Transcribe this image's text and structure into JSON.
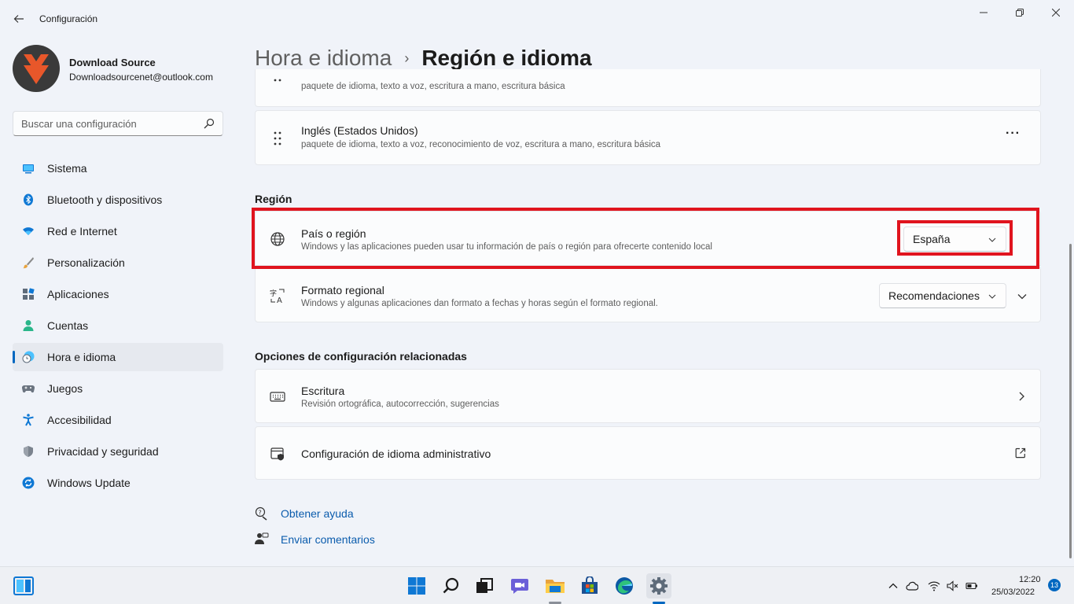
{
  "window": {
    "title": "Configuración",
    "back_icon": "arrow-left-icon",
    "controls": [
      "minimize-icon",
      "maximize-icon",
      "close-icon"
    ]
  },
  "user": {
    "name": "Download Source",
    "email": "Downloadsourcenet@outlook.com",
    "avatar_colors": {
      "bg": "#3a3a3a",
      "logo": "#e8572a"
    }
  },
  "search": {
    "placeholder": "Buscar una configuración",
    "icon": "search-icon"
  },
  "sidebar": {
    "items": [
      {
        "label": "Sistema",
        "icon": "system-icon",
        "active": false
      },
      {
        "label": "Bluetooth y dispositivos",
        "icon": "bluetooth-icon",
        "active": false
      },
      {
        "label": "Red e Internet",
        "icon": "wifi-icon",
        "active": false
      },
      {
        "label": "Personalización",
        "icon": "brush-icon",
        "active": false
      },
      {
        "label": "Aplicaciones",
        "icon": "apps-icon",
        "active": false
      },
      {
        "label": "Cuentas",
        "icon": "person-icon",
        "active": false
      },
      {
        "label": "Hora e idioma",
        "icon": "clock-globe-icon",
        "active": true
      },
      {
        "label": "Juegos",
        "icon": "gamepad-icon",
        "active": false
      },
      {
        "label": "Accesibilidad",
        "icon": "accessibility-icon",
        "active": false
      },
      {
        "label": "Privacidad y seguridad",
        "icon": "shield-icon",
        "active": false
      },
      {
        "label": "Windows Update",
        "icon": "update-icon",
        "active": false
      }
    ]
  },
  "breadcrumb": {
    "parent": "Hora e idioma",
    "separator": "›",
    "current": "Región e idioma"
  },
  "languages": [
    {
      "title": "",
      "desc": "paquete de idioma, texto a voz, escritura a mano, escritura básica"
    },
    {
      "title": "Inglés (Estados Unidos)",
      "desc": "paquete de idioma, texto a voz, reconocimiento de voz, escritura a mano, escritura básica",
      "more": "···"
    }
  ],
  "region": {
    "heading": "Región",
    "country": {
      "title": "País o región",
      "desc": "Windows y las aplicaciones pueden usar tu información de país o región para ofrecerte contenido local",
      "value": "España"
    },
    "format": {
      "title": "Formato regional",
      "desc": "Windows y algunas aplicaciones dan formato a fechas y horas según el formato regional.",
      "value": "Recomendaciones"
    }
  },
  "related": {
    "heading": "Opciones de configuración relacionadas",
    "typing": {
      "title": "Escritura",
      "desc": "Revisión ortográfica, autocorrección, sugerencias"
    },
    "admin": {
      "title": "Configuración de idioma administrativo"
    }
  },
  "help": {
    "get_help": "Obtener ayuda",
    "feedback": "Enviar comentarios"
  },
  "taskbar": {
    "time": "12:20",
    "date": "25/03/2022",
    "notifications": "13",
    "apps": [
      "widgets-icon",
      "start-icon",
      "search-icon",
      "task-view-icon",
      "chat-icon",
      "file-explorer-icon",
      "store-icon",
      "edge-icon",
      "settings-icon"
    ],
    "tray": [
      "chevron-up-icon",
      "onedrive-icon",
      "wifi-icon",
      "volume-muted-icon",
      "battery-icon"
    ]
  },
  "colors": {
    "accent": "#0067c0",
    "highlight": "#e0141e",
    "background": "#f0f3f9",
    "card": "#fbfcfd"
  }
}
